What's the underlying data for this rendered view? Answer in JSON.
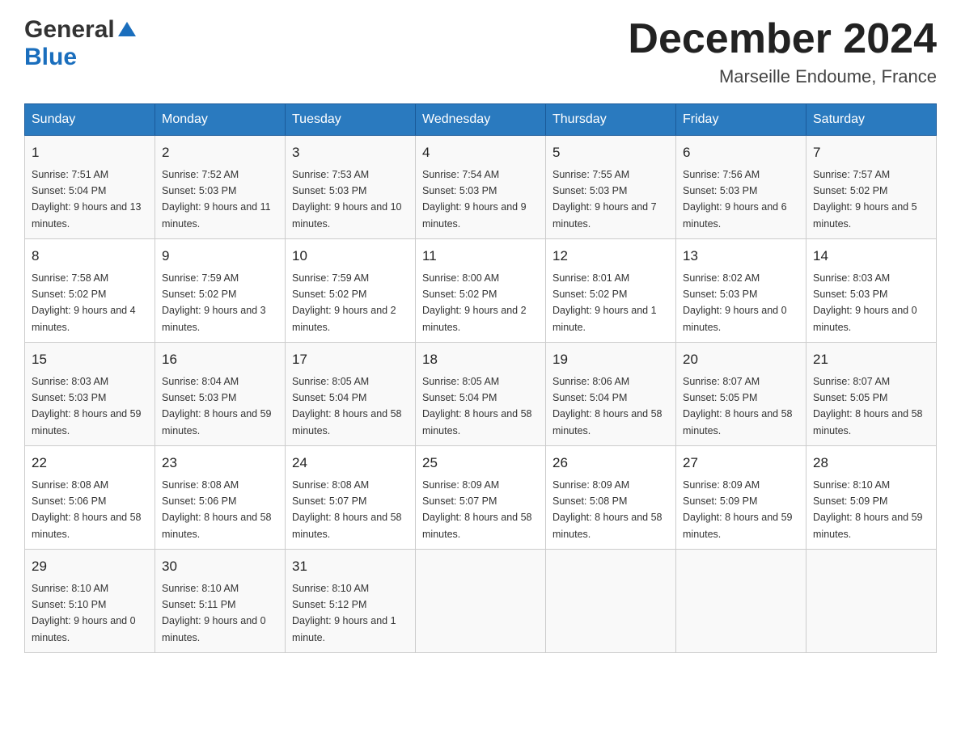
{
  "header": {
    "logo_general": "General",
    "logo_blue": "Blue",
    "month_title": "December 2024",
    "location": "Marseille Endoume, France"
  },
  "days_of_week": [
    "Sunday",
    "Monday",
    "Tuesday",
    "Wednesday",
    "Thursday",
    "Friday",
    "Saturday"
  ],
  "weeks": [
    [
      {
        "day": "1",
        "sunrise": "7:51 AM",
        "sunset": "5:04 PM",
        "daylight": "9 hours and 13 minutes."
      },
      {
        "day": "2",
        "sunrise": "7:52 AM",
        "sunset": "5:03 PM",
        "daylight": "9 hours and 11 minutes."
      },
      {
        "day": "3",
        "sunrise": "7:53 AM",
        "sunset": "5:03 PM",
        "daylight": "9 hours and 10 minutes."
      },
      {
        "day": "4",
        "sunrise": "7:54 AM",
        "sunset": "5:03 PM",
        "daylight": "9 hours and 9 minutes."
      },
      {
        "day": "5",
        "sunrise": "7:55 AM",
        "sunset": "5:03 PM",
        "daylight": "9 hours and 7 minutes."
      },
      {
        "day": "6",
        "sunrise": "7:56 AM",
        "sunset": "5:03 PM",
        "daylight": "9 hours and 6 minutes."
      },
      {
        "day": "7",
        "sunrise": "7:57 AM",
        "sunset": "5:02 PM",
        "daylight": "9 hours and 5 minutes."
      }
    ],
    [
      {
        "day": "8",
        "sunrise": "7:58 AM",
        "sunset": "5:02 PM",
        "daylight": "9 hours and 4 minutes."
      },
      {
        "day": "9",
        "sunrise": "7:59 AM",
        "sunset": "5:02 PM",
        "daylight": "9 hours and 3 minutes."
      },
      {
        "day": "10",
        "sunrise": "7:59 AM",
        "sunset": "5:02 PM",
        "daylight": "9 hours and 2 minutes."
      },
      {
        "day": "11",
        "sunrise": "8:00 AM",
        "sunset": "5:02 PM",
        "daylight": "9 hours and 2 minutes."
      },
      {
        "day": "12",
        "sunrise": "8:01 AM",
        "sunset": "5:02 PM",
        "daylight": "9 hours and 1 minute."
      },
      {
        "day": "13",
        "sunrise": "8:02 AM",
        "sunset": "5:03 PM",
        "daylight": "9 hours and 0 minutes."
      },
      {
        "day": "14",
        "sunrise": "8:03 AM",
        "sunset": "5:03 PM",
        "daylight": "9 hours and 0 minutes."
      }
    ],
    [
      {
        "day": "15",
        "sunrise": "8:03 AM",
        "sunset": "5:03 PM",
        "daylight": "8 hours and 59 minutes."
      },
      {
        "day": "16",
        "sunrise": "8:04 AM",
        "sunset": "5:03 PM",
        "daylight": "8 hours and 59 minutes."
      },
      {
        "day": "17",
        "sunrise": "8:05 AM",
        "sunset": "5:04 PM",
        "daylight": "8 hours and 58 minutes."
      },
      {
        "day": "18",
        "sunrise": "8:05 AM",
        "sunset": "5:04 PM",
        "daylight": "8 hours and 58 minutes."
      },
      {
        "day": "19",
        "sunrise": "8:06 AM",
        "sunset": "5:04 PM",
        "daylight": "8 hours and 58 minutes."
      },
      {
        "day": "20",
        "sunrise": "8:07 AM",
        "sunset": "5:05 PM",
        "daylight": "8 hours and 58 minutes."
      },
      {
        "day": "21",
        "sunrise": "8:07 AM",
        "sunset": "5:05 PM",
        "daylight": "8 hours and 58 minutes."
      }
    ],
    [
      {
        "day": "22",
        "sunrise": "8:08 AM",
        "sunset": "5:06 PM",
        "daylight": "8 hours and 58 minutes."
      },
      {
        "day": "23",
        "sunrise": "8:08 AM",
        "sunset": "5:06 PM",
        "daylight": "8 hours and 58 minutes."
      },
      {
        "day": "24",
        "sunrise": "8:08 AM",
        "sunset": "5:07 PM",
        "daylight": "8 hours and 58 minutes."
      },
      {
        "day": "25",
        "sunrise": "8:09 AM",
        "sunset": "5:07 PM",
        "daylight": "8 hours and 58 minutes."
      },
      {
        "day": "26",
        "sunrise": "8:09 AM",
        "sunset": "5:08 PM",
        "daylight": "8 hours and 58 minutes."
      },
      {
        "day": "27",
        "sunrise": "8:09 AM",
        "sunset": "5:09 PM",
        "daylight": "8 hours and 59 minutes."
      },
      {
        "day": "28",
        "sunrise": "8:10 AM",
        "sunset": "5:09 PM",
        "daylight": "8 hours and 59 minutes."
      }
    ],
    [
      {
        "day": "29",
        "sunrise": "8:10 AM",
        "sunset": "5:10 PM",
        "daylight": "9 hours and 0 minutes."
      },
      {
        "day": "30",
        "sunrise": "8:10 AM",
        "sunset": "5:11 PM",
        "daylight": "9 hours and 0 minutes."
      },
      {
        "day": "31",
        "sunrise": "8:10 AM",
        "sunset": "5:12 PM",
        "daylight": "9 hours and 1 minute."
      },
      null,
      null,
      null,
      null
    ]
  ],
  "labels": {
    "sunrise": "Sunrise:",
    "sunset": "Sunset:",
    "daylight": "Daylight:"
  }
}
